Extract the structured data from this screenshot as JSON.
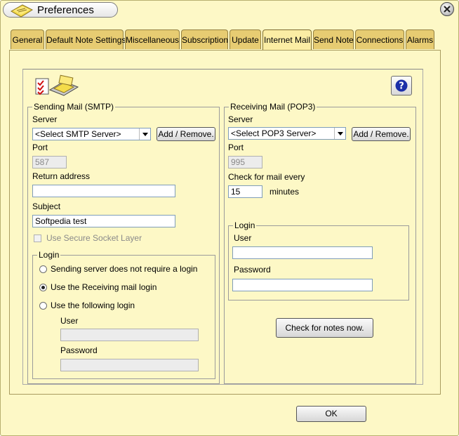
{
  "window": {
    "title": "Preferences"
  },
  "tabs": [
    {
      "label": "General"
    },
    {
      "label": "Default Note Settings"
    },
    {
      "label": "Miscellaneous"
    },
    {
      "label": "Subscription"
    },
    {
      "label": "Update"
    },
    {
      "label": "Internet Mail",
      "active": true
    },
    {
      "label": "Send Note"
    },
    {
      "label": "Connections"
    },
    {
      "label": "Alarms"
    }
  ],
  "smtp": {
    "group_title": "Sending Mail (SMTP)",
    "server_label": "Server",
    "server_selected": "<Select SMTP Server>",
    "add_remove_label": "Add / Remove.",
    "port_label": "Port",
    "port_value": "587",
    "return_label": "Return address",
    "return_value": "",
    "subject_label": "Subject",
    "subject_value": "Softpedia test",
    "ssl_label": "Use Secure Socket Layer",
    "login": {
      "group_title": "Login",
      "opt_no_login": "Sending server does not require a login",
      "opt_receiving": "Use the Receiving mail login",
      "opt_following": "Use the following login",
      "selected": "opt_receiving",
      "user_label": "User",
      "user_value": "",
      "password_label": "Password",
      "password_value": ""
    }
  },
  "pop3": {
    "group_title": "Receiving Mail (POP3)",
    "server_label": "Server",
    "server_selected": "<Select POP3 Server>",
    "add_remove_label": "Add / Remove.",
    "port_label": "Port",
    "port_value": "995",
    "check_label": "Check for mail every",
    "check_value": "15",
    "minutes_label": "minutes",
    "login": {
      "group_title": "Login",
      "user_label": "User",
      "user_value": "",
      "password_label": "Password",
      "password_value": ""
    },
    "check_now_label": "Check for notes now."
  },
  "ok_label": "OK",
  "icons": {
    "app": "sticky-note-icon",
    "close": "close-icon",
    "help": "help-question-icon",
    "mail": "mail-notes-icon"
  }
}
